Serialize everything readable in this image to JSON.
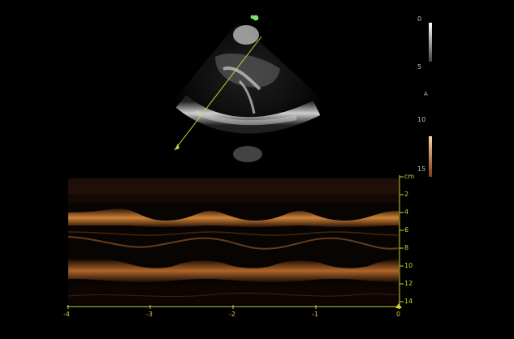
{
  "image_view": {
    "depth_scale_top": {
      "ticks": [
        "0",
        "5",
        "10",
        "15"
      ]
    },
    "small_marker": "A",
    "depth_unit": "cm",
    "depth_ticks": [
      "2",
      "4",
      "6",
      "8",
      "10",
      "12",
      "14"
    ],
    "time_ticks": [
      "-4",
      "-3",
      "-2",
      "-1",
      "0"
    ],
    "colors": {
      "accent_yellow": "#cfd23a",
      "mmode_orange": "#d98a3a",
      "probe_green": "#7ee06d",
      "gray_scale_light": "#ffffff",
      "orange_scale_dark": "#7a3b12"
    },
    "icons": [
      "probe-marker-icon",
      "cursor-line-icon",
      "time-marker-triangle-icon"
    ]
  }
}
